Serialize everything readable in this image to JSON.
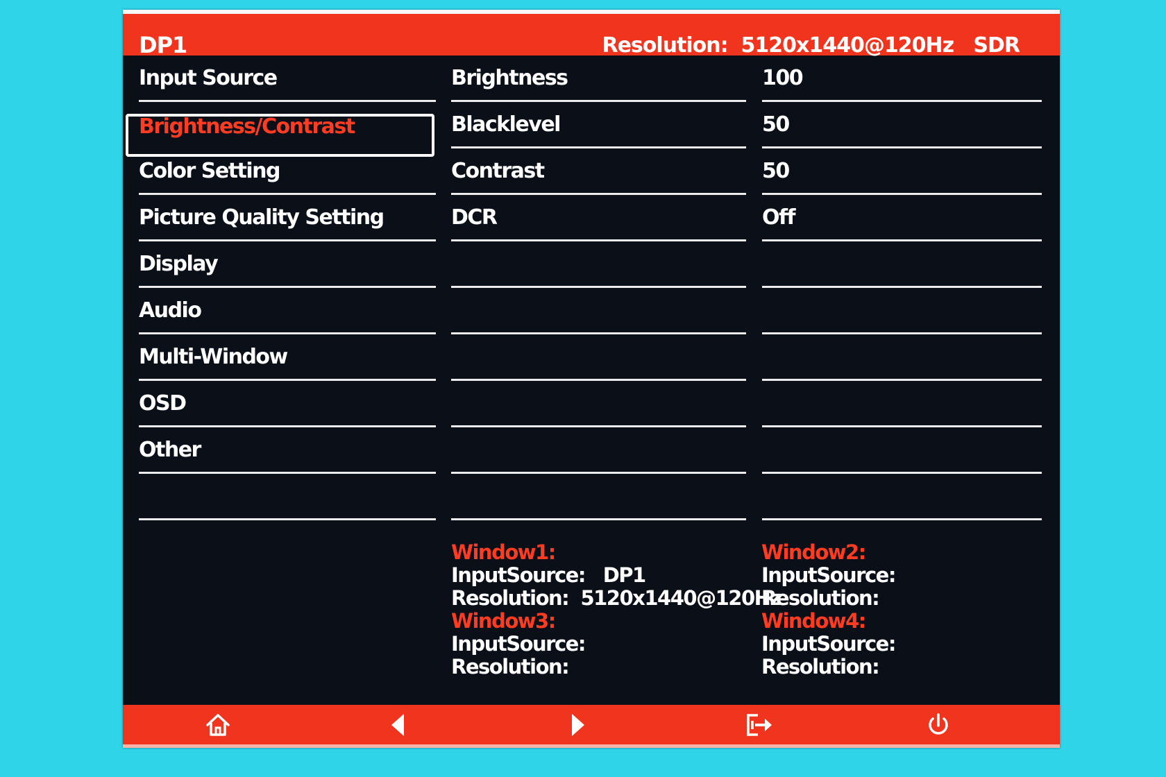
{
  "header": {
    "source": "DP1",
    "resolution_text": "Resolution:  5120x1440@120Hz   SDR"
  },
  "menu": [
    {
      "label": "Input Source"
    },
    {
      "label": "Brightness/Contrast",
      "selected": true
    },
    {
      "label": "Color Setting"
    },
    {
      "label": "Picture Quality Setting"
    },
    {
      "label": "Display"
    },
    {
      "label": "Audio"
    },
    {
      "label": "Multi-Window"
    },
    {
      "label": "OSD"
    },
    {
      "label": "Other"
    },
    {
      "label": ""
    }
  ],
  "params": [
    {
      "name": "Brightness",
      "value": "100"
    },
    {
      "name": "Blacklevel",
      "value": "50"
    },
    {
      "name": "Contrast",
      "value": "50"
    },
    {
      "name": "DCR",
      "value": "Off"
    },
    {
      "name": "",
      "value": ""
    },
    {
      "name": "",
      "value": ""
    },
    {
      "name": "",
      "value": ""
    },
    {
      "name": "",
      "value": ""
    },
    {
      "name": "",
      "value": ""
    },
    {
      "name": "",
      "value": ""
    }
  ],
  "windows": {
    "w1": {
      "title": "Window1:",
      "input_label": "InputSource:",
      "input_value": "DP1",
      "res_label": "Resolution:",
      "res_value": "5120x1440@120Hz"
    },
    "w2": {
      "title": "Window2:",
      "input_label": "InputSource:",
      "input_value": "",
      "res_label": "Resolution:",
      "res_value": ""
    },
    "w3": {
      "title": "Window3:",
      "input_label": "InputSource:",
      "input_value": "",
      "res_label": "Resolution:",
      "res_value": ""
    },
    "w4": {
      "title": "Window4:",
      "input_label": "InputSource:",
      "input_value": "",
      "res_label": "Resolution:",
      "res_value": ""
    }
  },
  "buttons": {
    "home": "home-icon",
    "left": "left-arrow-icon",
    "right": "right-arrow-icon",
    "exit": "exit-icon",
    "power": "power-icon"
  },
  "colors": {
    "accent": "#f0341d",
    "highlight_text": "#ff3b22",
    "panel": "#0a0f18",
    "backdrop": "#2fd4e8"
  }
}
